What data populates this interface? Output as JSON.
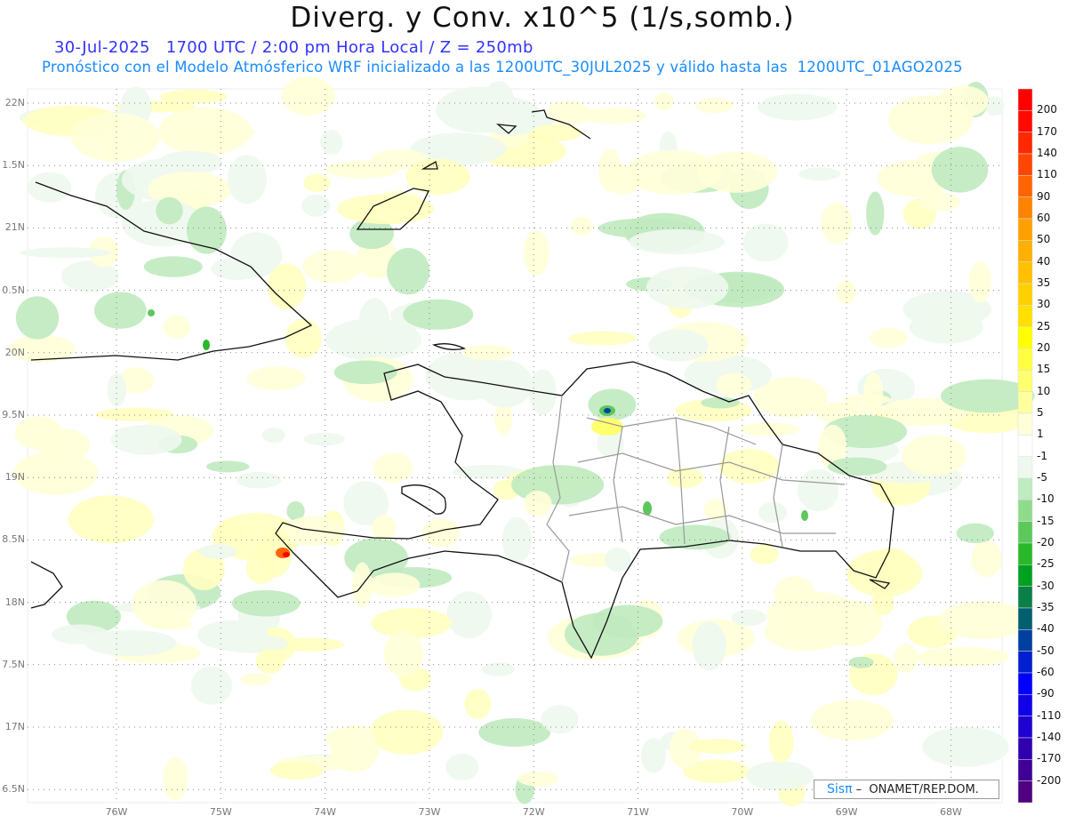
{
  "title": "Diverg. y Conv. x10^5 (1/s,somb.)",
  "subtitle_line1": "30-Jul-2025   1700 UTC / 2:00 pm Hora Local / Z = 250mb",
  "subtitle_line2": "Pronóstico con el Modelo Atmósferico WRF inicializado a las 1200UTC_30JUL2025 y válido hasta las  1200UTC_01AGO2025",
  "map": {
    "lat_labels": [
      "22N",
      "1.5N",
      "21N",
      "0.5N",
      "20N",
      "9.5N",
      "19N",
      "8.5N",
      "18N",
      "7.5N",
      "17N",
      "6.5N"
    ],
    "lon_labels": [
      "76W",
      "75W",
      "74W",
      "73W",
      "72W",
      "71W",
      "70W",
      "69W",
      "68W"
    ]
  },
  "colorbar": {
    "labels": [
      "200",
      "170",
      "140",
      "110",
      "90",
      "60",
      "50",
      "40",
      "35",
      "30",
      "25",
      "20",
      "15",
      "10",
      "5",
      "1",
      "-1",
      "-5",
      "-10",
      "-15",
      "-20",
      "-25",
      "-30",
      "-35",
      "-40",
      "-50",
      "-60",
      "-90",
      "-110",
      "-140",
      "-170",
      "-200"
    ],
    "colors": [
      "#ff0000",
      "#ff0a00",
      "#ff2800",
      "#ff4600",
      "#ff6400",
      "#ff8200",
      "#ffa000",
      "#ffb000",
      "#ffc000",
      "#ffd000",
      "#ffe000",
      "#ffff00",
      "#ffff40",
      "#ffff70",
      "#ffffa0",
      "#ffffd8",
      "#ffffff",
      "#eef8ee",
      "#c0eac0",
      "#8edb8e",
      "#5cc85c",
      "#2ab82a",
      "#00a020",
      "#0a8048",
      "#006070",
      "#0040a0",
      "#0020d0",
      "#0000ff",
      "#1000e8",
      "#2000d0",
      "#3000b0",
      "#400098",
      "#500080"
    ]
  },
  "credit": {
    "brand": "Sisπ",
    "org": "–  ONAMET/REP.DOM."
  }
}
